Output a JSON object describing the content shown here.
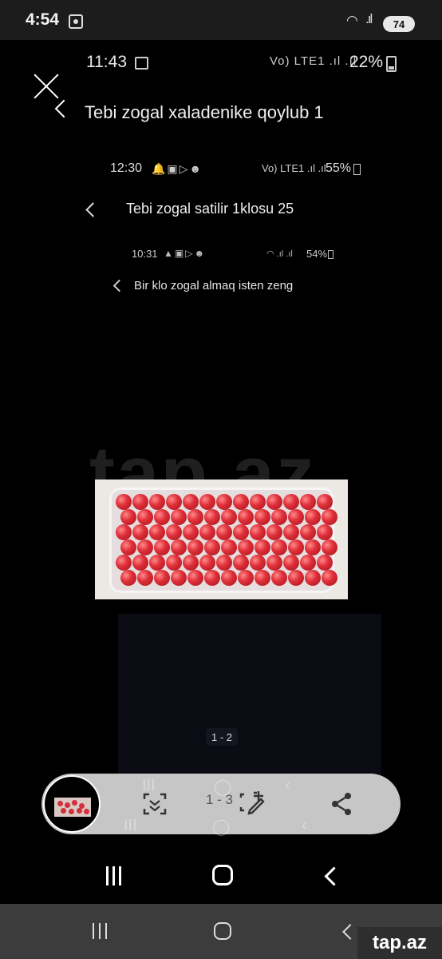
{
  "outer_status": {
    "time": "4:54",
    "battery": "74"
  },
  "level1": {
    "time": "11:43",
    "signal": "Vo) LTE1 .ıl .ıl",
    "battery": "22%",
    "title": "Tebi zogal xaladenike qoylub 1"
  },
  "level2": {
    "time": "12:30",
    "signal": "Vo) LTE1 .ıl .ıl",
    "battery": "55%",
    "title": "Tebi zogal satilir 1klosu 25"
  },
  "level3": {
    "time": "10:31",
    "battery": "54%",
    "title": "Bir klo zogal almaq isten zeng"
  },
  "watermark": "tap.az",
  "page_indicator_inner": "1 - 2",
  "toolbar": {
    "page_indicator": "1 - 3"
  },
  "brand": "tap.az",
  "icons": [
    "screenshot-icon",
    "gallery-icon",
    "close-icon",
    "back-icon",
    "scan-icon",
    "edit-icon",
    "share-icon",
    "recent-apps-icon",
    "home-icon",
    "nav-back-icon"
  ]
}
